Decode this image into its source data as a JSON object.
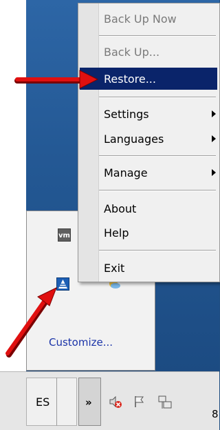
{
  "context_menu": {
    "items": [
      {
        "label": "Back Up Now",
        "disabled": true
      },
      {
        "label": "Back Up...",
        "disabled": true
      },
      {
        "label": "Restore...",
        "selected": true
      },
      {
        "label": "Settings",
        "submenu": true
      },
      {
        "label": "Languages",
        "submenu": true
      },
      {
        "label": "Manage",
        "submenu": true
      },
      {
        "label": "About"
      },
      {
        "label": "Help"
      },
      {
        "label": "Exit"
      }
    ]
  },
  "tray_popup": {
    "icons": [
      "vmware-tools-icon",
      "acronis-backup-icon",
      "cloud-icon"
    ],
    "vm_text": "vm",
    "customize_label": "Customize..."
  },
  "taskbar": {
    "language": "ES",
    "chevron": "»",
    "icons": [
      "speaker-muted-icon",
      "action-center-flag-icon",
      "network-icon"
    ],
    "clock_fragment": "8"
  },
  "colors": {
    "highlight": "#0a246a",
    "annotation_arrow": "#e01010",
    "desktop": "#245995"
  }
}
